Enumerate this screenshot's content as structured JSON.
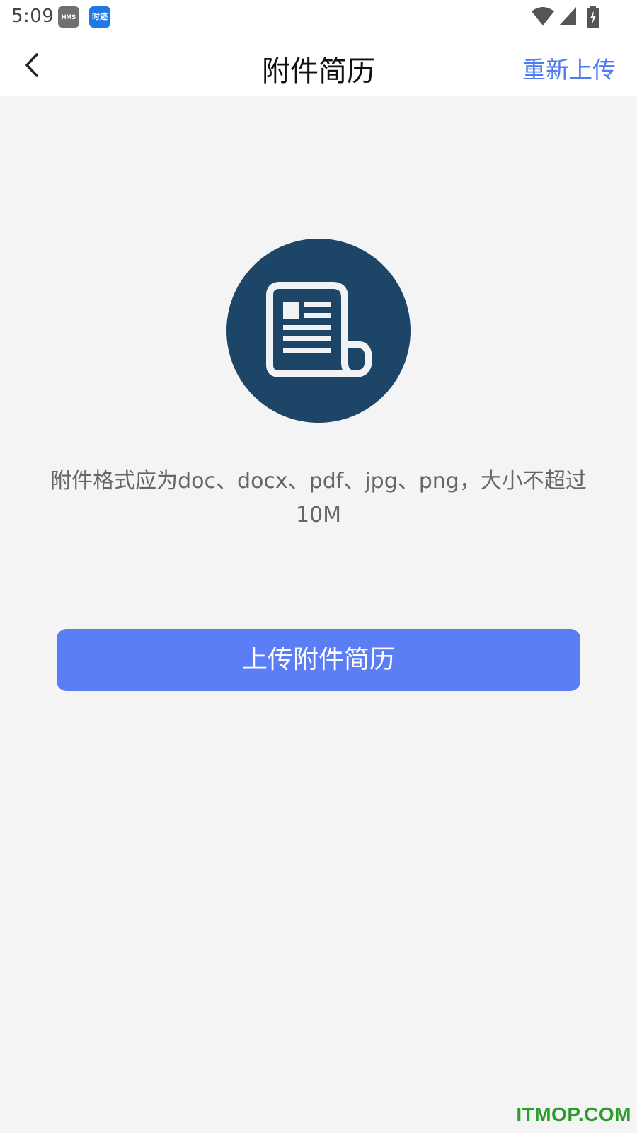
{
  "status_bar": {
    "time": "5:09",
    "badges": [
      "HMS",
      "时迹"
    ],
    "icons": [
      "wifi-icon",
      "signal-icon",
      "battery-charging-icon"
    ]
  },
  "nav": {
    "title": "附件简历",
    "back_icon": "chevron-left-icon",
    "action_label": "重新上传"
  },
  "main": {
    "illustration_icon": "document-icon",
    "hint_text": "附件格式应为doc、docx、pdf、jpg、png，大小不超过10M",
    "upload_button_label": "上传附件简历"
  },
  "watermark": "ITMOP.COM",
  "colors": {
    "accent": "#4f7af0",
    "button": "#5b7df5",
    "illustration_bg": "#1d4567",
    "background": "#f4f4f5"
  }
}
